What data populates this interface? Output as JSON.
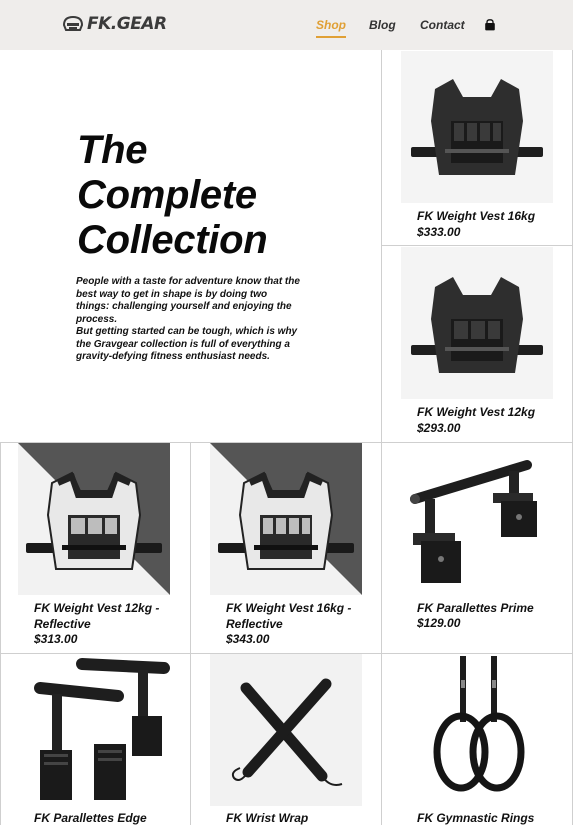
{
  "header": {
    "logo_text": "FK.GEAR",
    "nav": [
      {
        "label": "Shop",
        "active": true
      },
      {
        "label": "Blog",
        "active": false
      },
      {
        "label": "Contact",
        "active": false
      }
    ],
    "cart_icon": "shopping-bag-icon",
    "accent_color": "#e0a035"
  },
  "hero": {
    "title_line1": "The",
    "title_line2": "Complete",
    "title_line3": "Collection",
    "paragraph1": "People with a taste for adventure know that the best way to get in shape is by doing two things: challenging yourself and enjoying the process.",
    "paragraph2": "But getting started can be tough, which is why the Gravgear collection is full of everything a gravity-defying fitness enthusiast needs."
  },
  "products": [
    {
      "name": "FK Weight Vest 16kg",
      "price": "$333.00",
      "image": "weight-vest-black"
    },
    {
      "name": "FK Weight Vest 12kg",
      "price": "$293.00",
      "image": "weight-vest-black"
    },
    {
      "name": "FK Weight Vest 12kg - Reflective",
      "price": "$313.00",
      "image": "weight-vest-reflective"
    },
    {
      "name": "FK Weight Vest 16kg - Reflective",
      "price": "$343.00",
      "image": "weight-vest-reflective"
    },
    {
      "name": "FK Parallettes Prime",
      "price": "$129.00",
      "image": "parallettes"
    },
    {
      "name": "FK Parallettes Edge",
      "price": "",
      "image": "parallettes"
    },
    {
      "name": "FK Wrist Wrap",
      "price": "",
      "image": "wrist-wrap"
    },
    {
      "name": "FK Gymnastic Rings",
      "price": "",
      "image": "gymnastic-rings"
    }
  ]
}
